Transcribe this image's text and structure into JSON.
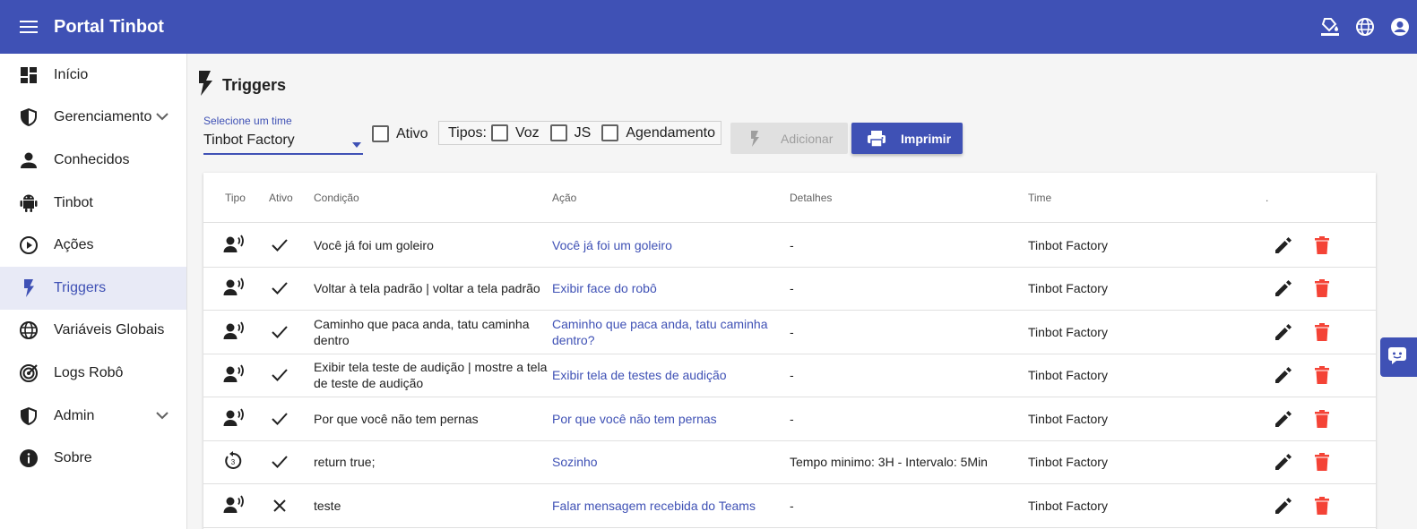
{
  "app": {
    "title": "Portal Tinbot"
  },
  "topbar_icons": [
    "palette-icon",
    "language-icon",
    "account-icon"
  ],
  "sidebar": {
    "items": [
      {
        "label": "Início",
        "icon": "dashboard-icon",
        "expandable": false,
        "active": false
      },
      {
        "label": "Gerenciamento",
        "icon": "shield-icon",
        "expandable": true,
        "active": false
      },
      {
        "label": "Conhecidos",
        "icon": "person-icon",
        "expandable": false,
        "active": false
      },
      {
        "label": "Tinbot",
        "icon": "android-icon",
        "expandable": false,
        "active": false
      },
      {
        "label": "Ações",
        "icon": "play-circle-icon",
        "expandable": false,
        "active": false
      },
      {
        "label": "Triggers",
        "icon": "flash-icon",
        "expandable": false,
        "active": true
      },
      {
        "label": "Variáveis Globais",
        "icon": "globe-icon",
        "expandable": false,
        "active": false
      },
      {
        "label": "Logs Robô",
        "icon": "radar-icon",
        "expandable": false,
        "active": false
      },
      {
        "label": "Admin",
        "icon": "shield-icon",
        "expandable": true,
        "active": false
      },
      {
        "label": "Sobre",
        "icon": "info-icon",
        "expandable": false,
        "active": false
      }
    ]
  },
  "page": {
    "title": "Triggers"
  },
  "filters": {
    "team_label": "Selecione um time",
    "team_value": "Tinbot Factory",
    "ativo_label": "Ativo",
    "tipos_label": "Tipos:",
    "tipos": [
      "Voz",
      "JS",
      "Agendamento"
    ],
    "add_label": "Adicionar",
    "print_label": "Imprimir"
  },
  "table": {
    "headers": {
      "tipo": "Tipo",
      "ativo": "Ativo",
      "condicao": "Condição",
      "acao": "Ação",
      "detalhes": "Detalhes",
      "time": "Time",
      "actions": "."
    },
    "rows": [
      {
        "tipo": "voice",
        "ativo": true,
        "condicao": "Você já foi um goleiro",
        "acao": "Você já foi um goleiro",
        "detalhes": "-",
        "time": "Tinbot Factory"
      },
      {
        "tipo": "voice",
        "ativo": true,
        "condicao": "Voltar à tela padrão | voltar a tela padrão",
        "acao": "Exibir face do robô",
        "detalhes": "-",
        "time": "Tinbot Factory"
      },
      {
        "tipo": "voice",
        "ativo": true,
        "condicao": "Caminho que paca anda, tatu caminha dentro",
        "acao": "Caminho que paca anda, tatu caminha dentro?",
        "detalhes": "-",
        "time": "Tinbot Factory"
      },
      {
        "tipo": "voice",
        "ativo": true,
        "condicao": "Exibir tela teste de audição | mostre a tela de teste de audição",
        "acao": "Exibir tela de testes de audição",
        "detalhes": "-",
        "time": "Tinbot Factory"
      },
      {
        "tipo": "voice",
        "ativo": true,
        "condicao": "Por que você não tem pernas",
        "acao": "Por que você não tem pernas",
        "detalhes": "-",
        "time": "Tinbot Factory"
      },
      {
        "tipo": "schedule",
        "ativo": true,
        "condicao": "return true;",
        "acao": "Sozinho",
        "detalhes": "Tempo minimo: 3H - Intervalo: 5Min",
        "time": "Tinbot Factory"
      },
      {
        "tipo": "voice",
        "ativo": false,
        "condicao": "teste",
        "acao": "Falar mensagem recebida do Teams",
        "detalhes": "-",
        "time": "Tinbot Factory"
      }
    ]
  },
  "colors": {
    "primary": "#3f51b5",
    "delete": "#f44336",
    "active_bg": "#e8eaf6"
  }
}
